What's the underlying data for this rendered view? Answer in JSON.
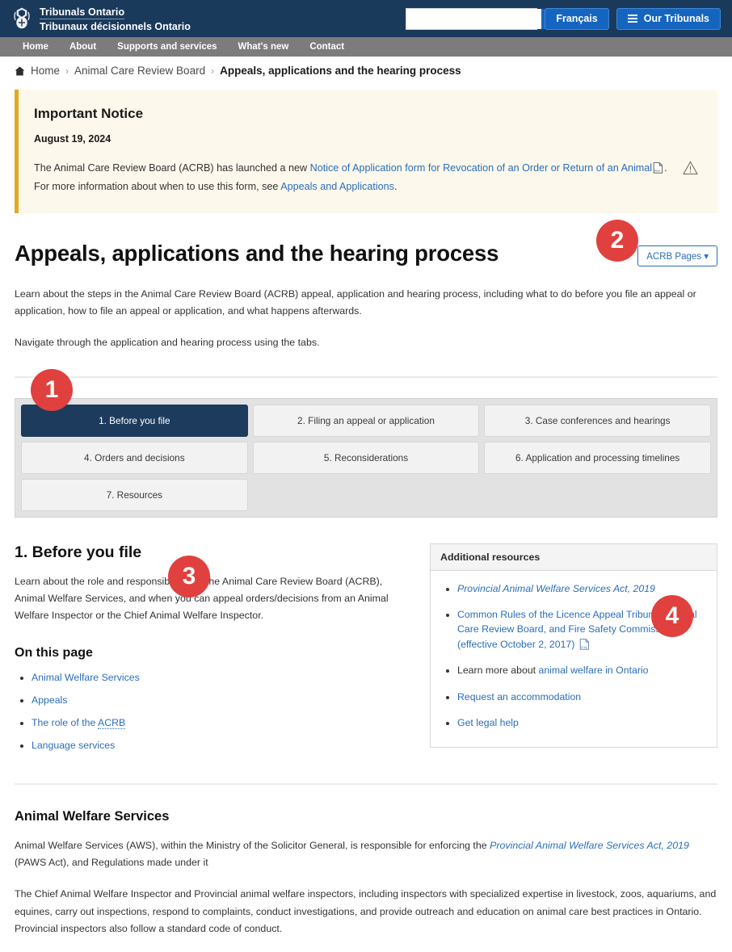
{
  "header": {
    "logo_name": "ontario-coat-of-arms",
    "brand_en": "Tribunals Ontario",
    "brand_fr": "Tribunaux décisionnels Ontario",
    "search": {
      "value": "",
      "placeholder": "",
      "icon": "search-icon"
    },
    "language_button": "Français",
    "tribunals_button": "Our Tribunals",
    "accent_blue": "#1565c0",
    "header_navy": "#1a3a5c"
  },
  "nav": {
    "items": [
      {
        "label": "Home"
      },
      {
        "label": "About"
      },
      {
        "label": "Supports and services"
      },
      {
        "label": "What's new"
      },
      {
        "label": "Contact"
      }
    ],
    "bar_color": "#7c7c7c"
  },
  "breadcrumb": {
    "home_icon": "home-icon",
    "items": [
      {
        "label": "Home",
        "current": false
      },
      {
        "label": "Animal Care Review Board",
        "current": false
      },
      {
        "label": "Appeals, applications and the hearing process",
        "current": true
      }
    ],
    "separator": "›"
  },
  "notice": {
    "title": "Important Notice",
    "date": "August 19, 2024",
    "body_part1": "The Animal Care Review Board (ACRB) has launched a new ",
    "link1": "Notice of Application form for Revocation of an Order or Return of an Animal",
    "pdf_icon": "pdf-file-icon",
    "body_part2": ". For more information about when to use this form, see ",
    "link2": "Appeals and Applications",
    "body_part3": ".",
    "warning_icon": "warning-triangle-icon",
    "background": "#fdf8ec",
    "border_color": "#e5a823"
  },
  "page": {
    "title": "Appeals, applications and the hearing process",
    "acrb_pages_button": "ACRB Pages",
    "acrb_pages_caret": "▾",
    "intro_paragraph_1": "Learn about the steps in the Animal Care Review Board (ACRB) appeal, application and hearing process, including what to do before you file an appeal or application, how to file an appeal or application, and what happens afterwards.",
    "intro_paragraph_2": "Navigate through the application and hearing process using the tabs."
  },
  "tabs": {
    "items": [
      {
        "label": "1. Before you file",
        "active": true
      },
      {
        "label": "2. Filing an appeal or application",
        "active": false
      },
      {
        "label": "3. Case conferences and hearings",
        "active": false
      },
      {
        "label": "4. Orders and decisions",
        "active": false
      },
      {
        "label": "5. Reconsiderations",
        "active": false
      },
      {
        "label": "6. Application and processing timelines",
        "active": false
      },
      {
        "label": "7. Resources",
        "active": false
      }
    ],
    "active_color": "#1d3b5c"
  },
  "section": {
    "heading": "1. Before you file",
    "lead": "Learn about the role and responsibilities of the Animal Care Review Board (ACRB), Animal Welfare Services, and when you can appeal orders/decisions from an Animal Welfare Inspector or the Chief Animal Welfare Inspector.",
    "on_this_page_heading": "On this page",
    "on_this_page_links": [
      {
        "label": "Animal Welfare Services"
      },
      {
        "label": "Appeals"
      },
      {
        "label_pre": "The role of the ",
        "abbr": "ACRB"
      },
      {
        "label": "Language services"
      }
    ]
  },
  "resources": {
    "heading": "Additional resources",
    "items": [
      {
        "text": "Provincial Animal Welfare Services Act, 2019",
        "italic": true,
        "link": true
      },
      {
        "text": "Common Rules of the Licence Appeal Tribunal, Animal Care Review Board, and Fire Safety Commission (effective October 2, 2017)",
        "italic": false,
        "link": true,
        "icon": "html-file-icon"
      },
      {
        "prefix": "Learn more about ",
        "text": "animal welfare in Ontario",
        "italic": false,
        "link": true
      },
      {
        "text": "Request an accommodation",
        "italic": false,
        "link": true
      },
      {
        "text": "Get legal help",
        "italic": false,
        "link": true
      }
    ]
  },
  "bottom": {
    "heading": "Animal Welfare Services",
    "p1_pre": "Animal Welfare Services (AWS), within the Ministry of the Solicitor General, is responsible for enforcing the ",
    "p1_link": "Provincial Animal Welfare Services Act, 2019",
    "p1_post": " (PAWS Act), and Regulations made under it",
    "p2": "The Chief Animal Welfare Inspector and Provincial animal welfare inspectors, including inspectors with specialized expertise in livestock, zoos, aquariums, and equines, carry out inspections, respond to complaints, conduct investigations, and provide outreach and education on animal care best practices in Ontario. Provincial inspectors also follow a standard code of conduct."
  },
  "annotations": {
    "badge_color": "#e0413e",
    "badges": [
      {
        "number": "1",
        "target": "tabs"
      },
      {
        "number": "2",
        "target": "acrb-pages-button"
      },
      {
        "number": "3",
        "target": "on-this-page"
      },
      {
        "number": "4",
        "target": "additional-resources"
      }
    ]
  }
}
